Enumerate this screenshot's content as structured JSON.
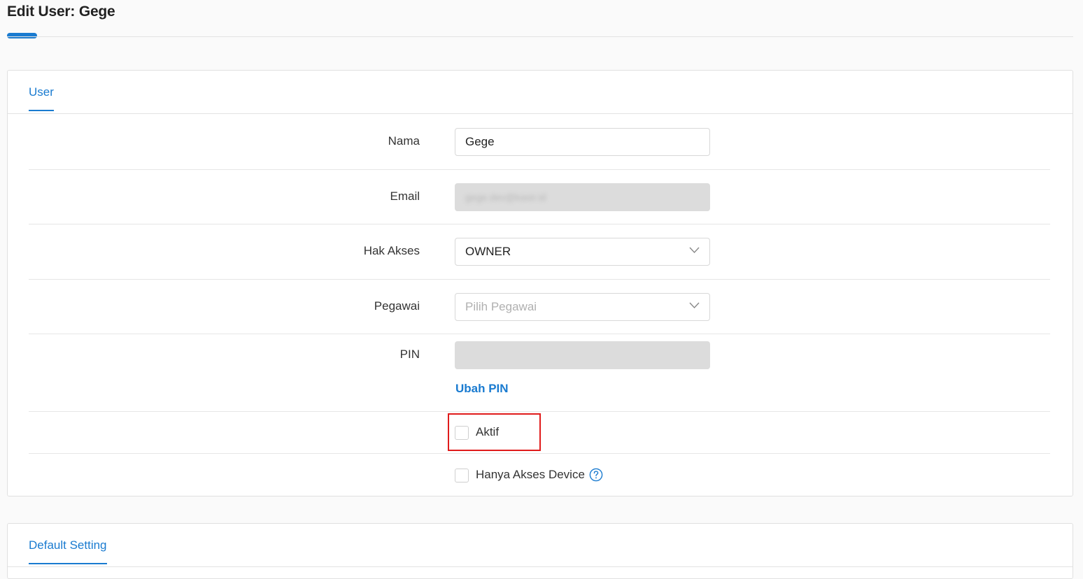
{
  "page": {
    "title": "Edit User: Gege"
  },
  "user_card": {
    "tab_label": "User",
    "fields": {
      "nama": {
        "label": "Nama",
        "value": "Gege"
      },
      "email": {
        "label": "Email",
        "value": "gege.dev@kasir.id"
      },
      "hak_akses": {
        "label": "Hak Akses",
        "value": "OWNER"
      },
      "pegawai": {
        "label": "Pegawai",
        "placeholder": "Pilih Pegawai"
      },
      "pin": {
        "label": "PIN",
        "value": "",
        "action_label": "Ubah PIN"
      }
    },
    "checkboxes": {
      "aktif": {
        "label": "Aktif",
        "checked": false
      },
      "hanya_akses_device": {
        "label": "Hanya Akses Device",
        "checked": false
      }
    }
  },
  "default_card": {
    "tab_label": "Default Setting"
  },
  "icons": {
    "dropdown": "chevron-down-icon",
    "help": "question-circle-icon"
  },
  "colors": {
    "accent": "#1a7bd0",
    "highlight": "#e01b1b",
    "disabled_field": "#dcdcdc"
  }
}
